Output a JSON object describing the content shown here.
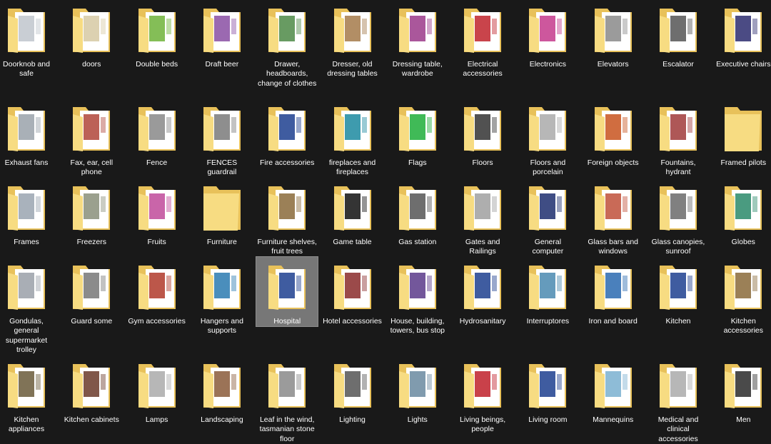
{
  "items": [
    {
      "label": "Doorknob and safe",
      "thumb": "door-hardware",
      "accent": "#bfc6cc"
    },
    {
      "label": "doors",
      "thumb": "door",
      "accent": "#d6c9a3"
    },
    {
      "label": "Double beds",
      "thumb": "bed",
      "accent": "#6fb33a"
    },
    {
      "label": "Draft beer",
      "thumb": "beer-tap",
      "accent": "#8a4fa3"
    },
    {
      "label": "Drawer, headboards, change of clothes",
      "thumb": "drawer",
      "accent": "#4d8a46"
    },
    {
      "label": "Dresser, old dressing tables",
      "thumb": "dresser",
      "accent": "#a57a4a"
    },
    {
      "label": "Dressing table, wardrobe",
      "thumb": "wardrobe",
      "accent": "#9b3a8a"
    },
    {
      "label": "Electrical accessories",
      "thumb": "electrical",
      "accent": "#c0232b"
    },
    {
      "label": "Electronics",
      "thumb": "electronics",
      "accent": "#c43a8c"
    },
    {
      "label": "Elevators",
      "thumb": "elevator",
      "accent": "#8a8a8a"
    },
    {
      "label": "Escalator",
      "thumb": "escalator",
      "accent": "#555555"
    },
    {
      "label": "Executive chairs",
      "thumb": "chair",
      "accent": "#2c2c6e"
    },
    {
      "label": "Exhaust fans",
      "thumb": "fan",
      "accent": "#9aa2aa"
    },
    {
      "label": "Fax, ear, cell phone",
      "thumb": "fax",
      "accent": "#b0453a"
    },
    {
      "label": "Fence",
      "thumb": "fence",
      "accent": "#888888"
    },
    {
      "label": "FENCES guardrail",
      "thumb": "guardrail",
      "accent": "#7a7a7a"
    },
    {
      "label": "Fire accessories",
      "thumb": "fire",
      "accent": "#1d3f8f"
    },
    {
      "label": "fireplaces and fireplaces",
      "thumb": "fireplace",
      "accent": "#1c8aa0"
    },
    {
      "label": "Flags",
      "thumb": "flags",
      "accent": "#1fae3a"
    },
    {
      "label": "Floors",
      "thumb": "floors",
      "accent": "#333333"
    },
    {
      "label": "Floors and porcelain",
      "thumb": "porcelain",
      "accent": "#aaaaaa"
    },
    {
      "label": "Foreign objects",
      "thumb": "foreign",
      "accent": "#c8541e"
    },
    {
      "label": "Fountains, hydrant",
      "thumb": "hydrant",
      "accent": "#a03a3a"
    },
    {
      "label": "Framed pilots",
      "thumb": "empty",
      "accent": ""
    },
    {
      "label": "Frames",
      "thumb": "frames",
      "accent": "#9aa4b0"
    },
    {
      "label": "Freezers",
      "thumb": "freezer",
      "accent": "#8a8f7a"
    },
    {
      "label": "Fruits",
      "thumb": "fruits",
      "accent": "#c04a9a"
    },
    {
      "label": "Furniture",
      "thumb": "empty",
      "accent": ""
    },
    {
      "label": "Furniture shelves, fruit trees",
      "thumb": "shelves",
      "accent": "#8a6a3a"
    },
    {
      "label": "Game table",
      "thumb": "game-table",
      "accent": "#111111"
    },
    {
      "label": "Gas station",
      "thumb": "gas",
      "accent": "#555555"
    },
    {
      "label": "Gates and Railings",
      "thumb": "gates",
      "accent": "#a0a0a0"
    },
    {
      "label": "General computer",
      "thumb": "computer",
      "accent": "#1d2e6f"
    },
    {
      "label": "Glass bars and windows",
      "thumb": "glass-bars",
      "accent": "#c0503a"
    },
    {
      "label": "Glass canopies, sunroof",
      "thumb": "canopy",
      "accent": "#6a6a6a"
    },
    {
      "label": "Globes",
      "thumb": "globe",
      "accent": "#2a8a6a"
    },
    {
      "label": "Gondulas, general supermarket trolley",
      "thumb": "gondola",
      "accent": "#9aa0a8"
    },
    {
      "label": "Guard some",
      "thumb": "guard",
      "accent": "#777777"
    },
    {
      "label": "Gym accessories",
      "thumb": "gym",
      "accent": "#b03a2a"
    },
    {
      "label": "Hangers and supports",
      "thumb": "hanger",
      "accent": "#2a7ab0"
    },
    {
      "label": "Hospital",
      "thumb": "hospital",
      "accent": "#1d3f8f"
    },
    {
      "label": "Hotel accessories",
      "thumb": "hotel",
      "accent": "#8a2a2a"
    },
    {
      "label": "House, building, towers, bus stop",
      "thumb": "house",
      "accent": "#5a3a8a"
    },
    {
      "label": "Hydrosanitary",
      "thumb": "hydro",
      "accent": "#1d3f8f"
    },
    {
      "label": "Interruptores",
      "thumb": "switch",
      "accent": "#4a8ab0"
    },
    {
      "label": "Iron and board",
      "thumb": "iron",
      "accent": "#2a6ab0"
    },
    {
      "label": "Kitchen",
      "thumb": "kitchen",
      "accent": "#1d3f8f"
    },
    {
      "label": "Kitchen accessories",
      "thumb": "kitchen-acc",
      "accent": "#8a6a3a"
    },
    {
      "label": "Kitchen appliances",
      "thumb": "appliance",
      "accent": "#6a5a3a"
    },
    {
      "label": "Kitchen cabinets",
      "thumb": "cabinet",
      "accent": "#6a3a2a"
    },
    {
      "label": "Lamps",
      "thumb": "lamps",
      "accent": "#aaaaaa"
    },
    {
      "label": "Landscaping",
      "thumb": "landscape",
      "accent": "#8a5a3a"
    },
    {
      "label": "Leaf in the wind, tasmanian stone floor",
      "thumb": "leaf",
      "accent": "#8a8a8a"
    },
    {
      "label": "Lighting",
      "thumb": "lighting",
      "accent": "#555555"
    },
    {
      "label": "Lights",
      "thumb": "lights",
      "accent": "#6a8aa0"
    },
    {
      "label": "Living beings, people",
      "thumb": "people",
      "accent": "#c0202a"
    },
    {
      "label": "Living room",
      "thumb": "living",
      "accent": "#1d3f8f"
    },
    {
      "label": "Mannequins",
      "thumb": "mannequin",
      "accent": "#7ab0d0"
    },
    {
      "label": "Medical and clinical accessories",
      "thumb": "medical",
      "accent": "#aaaaaa"
    },
    {
      "label": "Men",
      "thumb": "men",
      "accent": "#2a2a2a"
    }
  ],
  "selected_label": "Hospital",
  "colors": {
    "folder_back": "#e8c15a",
    "folder_front": "#f7dc82",
    "paper": "#ffffff",
    "background": "#191919",
    "selection": "#777777"
  }
}
